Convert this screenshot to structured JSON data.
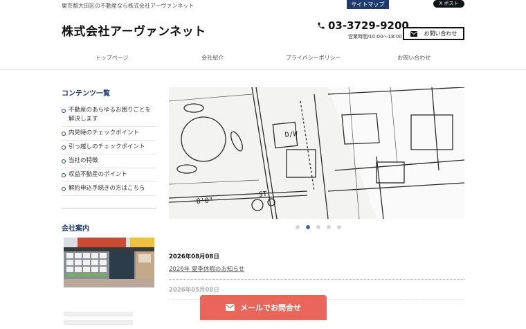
{
  "header": {
    "tagline": "東京都大田区の不動産なら株式会社アーヴァンネット",
    "sitemap_label": "サイトマップ",
    "post_label": "X ポスト",
    "logo": "株式会社アーヴァンネット",
    "phone": "03-3729-9200",
    "hours": "営業時間/10:00〜18:00",
    "contact_label": "お問い合わせ"
  },
  "nav": {
    "items": [
      {
        "label": "トップページ"
      },
      {
        "label": "会社紹介"
      },
      {
        "label": "プライバシーポリシー"
      },
      {
        "label": "お問い合わせ"
      }
    ]
  },
  "sidebar": {
    "contents_title": "コンテンツ一覧",
    "items": [
      {
        "label": "不動産のあらゆるお困りごとを解決します"
      },
      {
        "label": "内見時のチェックポイント"
      },
      {
        "label": "引っ越しのチェックポイント"
      },
      {
        "label": "当社の特徴"
      },
      {
        "label": "収益不動産のポイント"
      },
      {
        "label": "解約申込手続きの方はこちら"
      }
    ],
    "company_title": "会社案内"
  },
  "news": {
    "items": [
      {
        "date": "2026年08月08日",
        "title": "2026年 夏季休暇のお知らせ"
      },
      {
        "date": "2026年05月08日",
        "title": ""
      }
    ]
  },
  "mail_label": "メールでお問合せ",
  "colors": {
    "navy": "#1f3a6d",
    "cta": "#e8675a",
    "active_dot": "#4a67a8"
  }
}
